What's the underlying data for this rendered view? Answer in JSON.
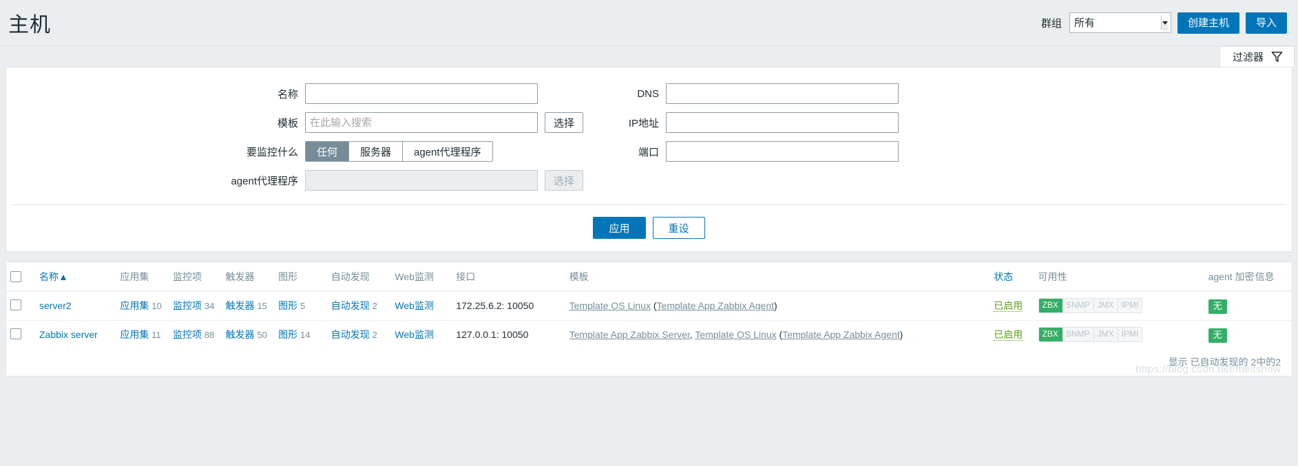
{
  "header": {
    "title": "主机",
    "group_label": "群组",
    "group_value": "所有",
    "group_options": [
      "所有"
    ],
    "create_host_label": "创建主机",
    "import_label": "导入"
  },
  "filter_tab": {
    "label": "过滤器",
    "icon": "funnel-icon"
  },
  "filter": {
    "name_label": "名称",
    "name_value": "",
    "template_label": "模板",
    "template_value": "",
    "template_placeholder": "在此输入搜索",
    "template_select_label": "选择",
    "monitored_by_label": "要监控什么",
    "monitored_by_options": [
      "任何",
      "服务器",
      "agent代理程序"
    ],
    "monitored_by_selected": "任何",
    "proxy_label": "agent代理程序",
    "proxy_value": "",
    "proxy_select_label": "选择",
    "dns_label": "DNS",
    "dns_value": "",
    "ip_label": "IP地址",
    "ip_value": "",
    "port_label": "端口",
    "port_value": "",
    "apply_label": "应用",
    "reset_label": "重设"
  },
  "table": {
    "columns": [
      "名称",
      "应用集",
      "监控项",
      "触发器",
      "图形",
      "自动发现",
      "Web监测",
      "接口",
      "模板",
      "状态",
      "可用性",
      "agent 加密",
      "信息"
    ],
    "sort_column": "名称",
    "sort_indicator": "▲",
    "rows": [
      {
        "name": "server2",
        "applications_label": "应用集",
        "applications_count": "10",
        "items_label": "监控项",
        "items_count": "34",
        "triggers_label": "触发器",
        "triggers_count": "15",
        "graphs_label": "图形",
        "graphs_count": "5",
        "discovery_label": "自动发现",
        "discovery_count": "2",
        "web_label": "Web监测",
        "interface": "172.25.6.2: 10050",
        "templates_text": "Template OS Linux (Template App Zabbix Agent)",
        "templates": [
          {
            "text": "Template OS Linux",
            "link": true
          },
          {
            "text": " (",
            "link": false
          },
          {
            "text": "Template App Zabbix Agent",
            "link": true
          },
          {
            "text": ")",
            "link": false
          }
        ],
        "status": "已启用",
        "availability": [
          {
            "label": "ZBX",
            "active": true
          },
          {
            "label": "SNMP",
            "active": false
          },
          {
            "label": "JMX",
            "active": false
          },
          {
            "label": "IPMI",
            "active": false
          }
        ],
        "encryption": "无",
        "info": ""
      },
      {
        "name": "Zabbix server",
        "applications_label": "应用集",
        "applications_count": "11",
        "items_label": "监控项",
        "items_count": "88",
        "triggers_label": "触发器",
        "triggers_count": "50",
        "graphs_label": "图形",
        "graphs_count": "14",
        "discovery_label": "自动发现",
        "discovery_count": "2",
        "web_label": "Web监测",
        "interface": "127.0.0.1: 10050",
        "templates_text": "Template App Zabbix Server, Template OS Linux (Template App Zabbix Agent)",
        "templates": [
          {
            "text": "Template App Zabbix Server",
            "link": true
          },
          {
            "text": ", ",
            "link": false
          },
          {
            "text": "Template OS Linux",
            "link": true
          },
          {
            "text": " (",
            "link": false
          },
          {
            "text": "Template App Zabbix Agent",
            "link": true
          },
          {
            "text": ")",
            "link": false
          }
        ],
        "status": "已启用",
        "availability": [
          {
            "label": "ZBX",
            "active": true
          },
          {
            "label": "SNMP",
            "active": false
          },
          {
            "label": "JMX",
            "active": false
          },
          {
            "label": "IPMI",
            "active": false
          }
        ],
        "encryption": "无",
        "info": ""
      }
    ],
    "footer": "显示 已自动发现的 2中的2",
    "watermark": "https://blog.csdn.net/meltshow"
  },
  "colors": {
    "accent": "#0275b8",
    "green": "#34af67",
    "status_green": "#59a112",
    "muted": "#768d99",
    "page_bg": "#ebeef0"
  }
}
